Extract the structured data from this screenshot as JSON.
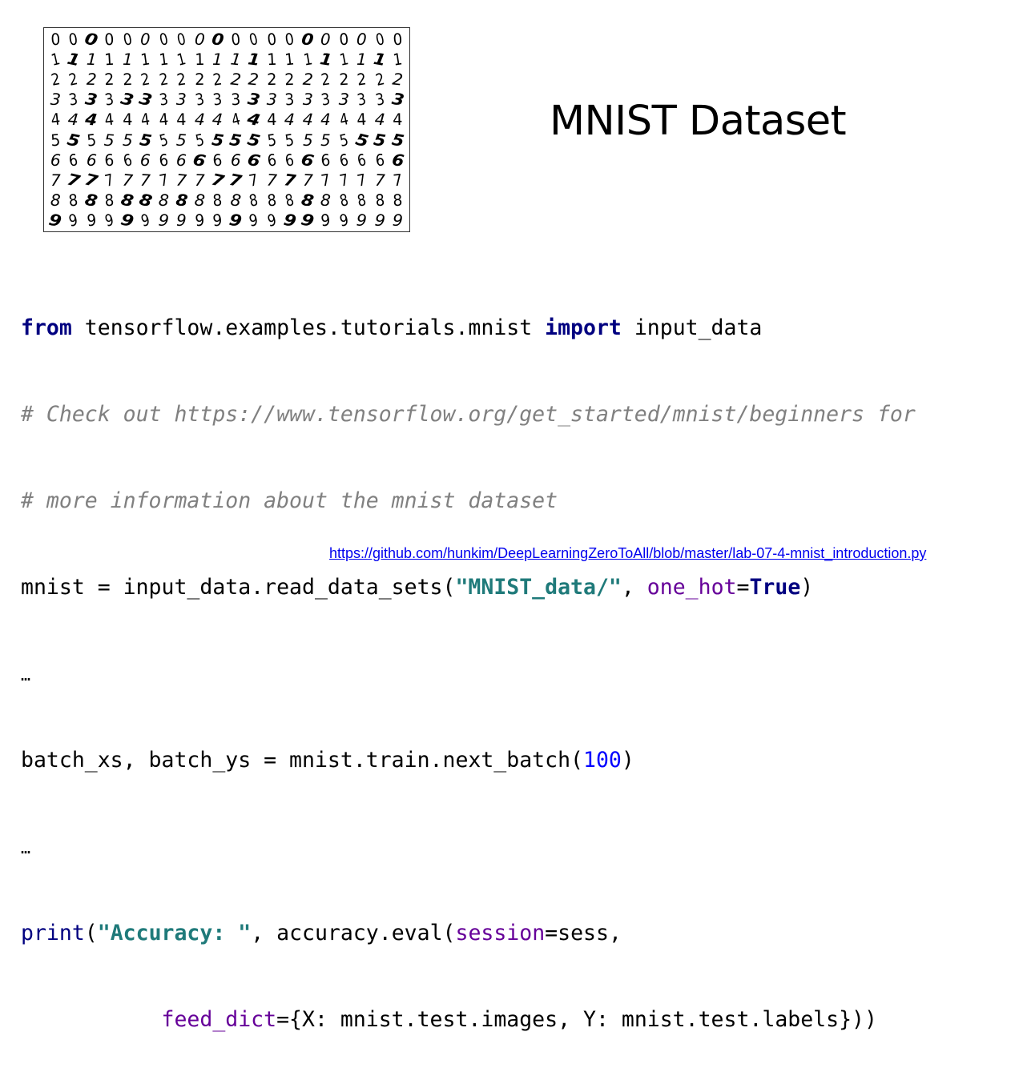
{
  "title": "MNIST Dataset",
  "mnist_image": {
    "rows": [
      [
        "0",
        "0",
        "0",
        "0",
        "0",
        "0",
        "0",
        "0",
        "0",
        "0",
        "0",
        "0",
        "0",
        "0",
        "0",
        "0",
        "0",
        "0",
        "0",
        "0"
      ],
      [
        "1",
        "1",
        "1",
        "1",
        "1",
        "1",
        "1",
        "1",
        "1",
        "1",
        "1",
        "1",
        "1",
        "1",
        "1",
        "1",
        "1",
        "1",
        "1",
        "1"
      ],
      [
        "2",
        "2",
        "2",
        "2",
        "2",
        "2",
        "2",
        "2",
        "2",
        "2",
        "2",
        "2",
        "2",
        "2",
        "2",
        "2",
        "2",
        "2",
        "2",
        "2"
      ],
      [
        "3",
        "3",
        "3",
        "3",
        "3",
        "3",
        "3",
        "3",
        "3",
        "3",
        "3",
        "3",
        "3",
        "3",
        "3",
        "3",
        "3",
        "3",
        "3",
        "3"
      ],
      [
        "4",
        "4",
        "4",
        "4",
        "4",
        "4",
        "4",
        "4",
        "4",
        "4",
        "4",
        "4",
        "4",
        "4",
        "4",
        "4",
        "4",
        "4",
        "4",
        "4"
      ],
      [
        "5",
        "5",
        "5",
        "5",
        "5",
        "5",
        "5",
        "5",
        "5",
        "5",
        "5",
        "5",
        "5",
        "5",
        "5",
        "5",
        "5",
        "5",
        "5",
        "5"
      ],
      [
        "6",
        "6",
        "6",
        "6",
        "6",
        "6",
        "6",
        "6",
        "6",
        "6",
        "6",
        "6",
        "6",
        "6",
        "6",
        "6",
        "6",
        "6",
        "6",
        "6"
      ],
      [
        "7",
        "7",
        "7",
        "7",
        "7",
        "7",
        "7",
        "7",
        "7",
        "7",
        "7",
        "7",
        "7",
        "7",
        "7",
        "7",
        "7",
        "7",
        "7",
        "7"
      ],
      [
        "8",
        "8",
        "8",
        "8",
        "8",
        "8",
        "8",
        "8",
        "8",
        "8",
        "8",
        "8",
        "8",
        "8",
        "8",
        "8",
        "8",
        "8",
        "8",
        "8"
      ],
      [
        "9",
        "9",
        "9",
        "9",
        "9",
        "9",
        "9",
        "9",
        "9",
        "9",
        "9",
        "9",
        "9",
        "9",
        "9",
        "9",
        "9",
        "9",
        "9",
        "9"
      ]
    ]
  },
  "code": {
    "line1": {
      "kw1": "from",
      "t1": " tensorflow.examples.tutorials.mnist ",
      "kw2": "import",
      "t2": " input_data"
    },
    "line2": {
      "comment": "# Check out https://www.tensorflow.org/get_started/mnist/beginners for"
    },
    "line3": {
      "comment": "# more information about the mnist dataset"
    },
    "line4": {
      "t1": "mnist = input_data.read_data_sets(",
      "str": "\"MNIST_data/\"",
      "t2": ", ",
      "param": "one_hot",
      "t3": "=",
      "bool": "True",
      "t4": ")"
    },
    "line5": {
      "text": "…"
    },
    "line6": {
      "t1": "batch_xs, batch_ys = mnist.train.next_batch(",
      "num": "100",
      "t2": ")"
    },
    "line7": {
      "text": "…"
    },
    "line8": {
      "builtin": "print",
      "t1": "(",
      "str": "\"Accuracy: \"",
      "t2": ", accuracy.eval(",
      "param": "session",
      "t3": "=sess,"
    },
    "line9": {
      "indent": "           ",
      "param": "feed_dict",
      "t1": "={X: mnist.test.images, Y: mnist.test.labels}))"
    }
  },
  "source_link": "https://github.com/hunkim/DeepLearningZeroToAll/blob/master/lab-07-4-mnist_introduction.py",
  "colors": {
    "keyword": "#000080",
    "comment": "#808080",
    "string": "#1f7a7a",
    "param": "#660099",
    "number": "#0000ff",
    "link": "#0000ee"
  }
}
